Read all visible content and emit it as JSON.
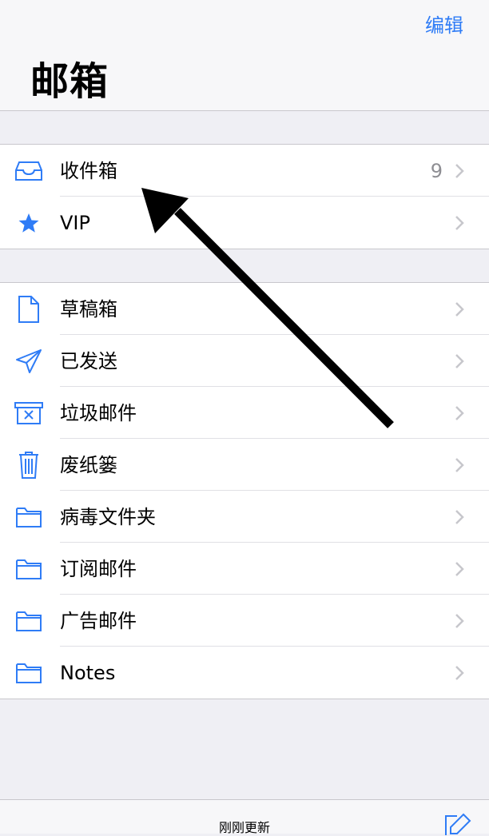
{
  "nav": {
    "edit_label": "编辑",
    "title": "邮箱"
  },
  "group1": [
    {
      "icon": "inbox-tray-icon",
      "label": "收件箱",
      "count": "9"
    },
    {
      "icon": "star-icon",
      "label": "VIP"
    }
  ],
  "group2": [
    {
      "icon": "document-icon",
      "label": "草稿箱"
    },
    {
      "icon": "paper-plane-icon",
      "label": "已发送"
    },
    {
      "icon": "junk-box-icon",
      "label": "垃圾邮件"
    },
    {
      "icon": "trash-can-icon",
      "label": "废纸篓"
    },
    {
      "icon": "folder-icon",
      "label": "病毒文件夹"
    },
    {
      "icon": "folder-icon",
      "label": "订阅邮件"
    },
    {
      "icon": "folder-icon",
      "label": "广告邮件"
    },
    {
      "icon": "folder-icon",
      "label": "Notes"
    }
  ],
  "toolbar": {
    "status": "刚刚更新",
    "compose_icon": "compose-icon"
  },
  "colors": {
    "accent": "#2f7cf6",
    "background": "#efeff4",
    "chevron": "#c7c7cc",
    "arrow": "#000000"
  }
}
